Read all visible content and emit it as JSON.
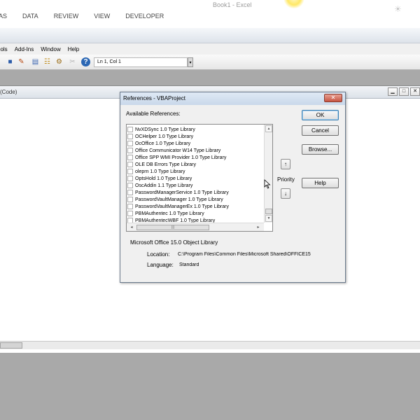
{
  "excel": {
    "title": "Book1 - Excel",
    "ribbon_tabs": [
      "AS",
      "DATA",
      "REVIEW",
      "VIEW",
      "DEVELOPER"
    ]
  },
  "vbe": {
    "menus": [
      "ools",
      "Add-Ins",
      "Window",
      "Help"
    ],
    "status": "Ln 1, Col 1",
    "code_window_title": "(Code)"
  },
  "dialog": {
    "title": "References - VBAProject",
    "available_label": "Available References:",
    "references": [
      "NvXDSync 1.0 Type Library",
      "OCHelper 1.0 Type Library",
      "OcOffice 1.0 Type Library",
      "Office Communicator W14 Type Library",
      "Office SPP WMI Provider 1.0 Type Library",
      "OLE DB Errors Type Library",
      "oleprn 1.0 Type Library",
      "OptsHold 1.0 Type Library",
      "OscAddin 1.1 Type Library",
      "PasswordManagerService 1.0 Type Library",
      "PasswordVaultManager 1.0 Type Library",
      "PasswordVaultManagerEx 1.0 Type Library",
      "PBMAuthentec 1.0 Type Library",
      "PBMAuthentecWBF 1.0 Type Library"
    ],
    "buttons": {
      "ok": "OK",
      "cancel": "Cancel",
      "browse": "Browse...",
      "help": "Help"
    },
    "priority_label": "Priority",
    "priority_up": "↑",
    "priority_down": "↓",
    "selected_name": "Microsoft Office 15.0 Object Library",
    "location_label": "Location:",
    "location_value": "C:\\Program Files\\Common Files\\Microsoft Shared\\OFFICE15",
    "language_label": "Language:",
    "language_value": "Standard"
  },
  "colors": {
    "dialog_titlebar": "#c9d8ea",
    "close_button": "#c75442",
    "workspace": "#a9a9a9"
  }
}
